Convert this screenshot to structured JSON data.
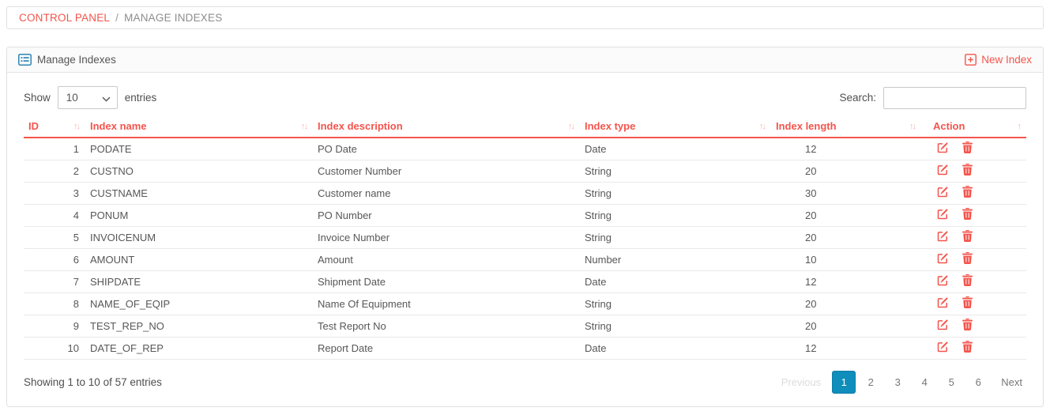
{
  "breadcrumb": {
    "control_panel": "CONTROL PANEL",
    "separator": "/",
    "current": "MANAGE INDEXES"
  },
  "panel": {
    "title": "Manage Indexes",
    "new_index_label": "New Index"
  },
  "controls": {
    "show_label": "Show",
    "page_length": "10",
    "entries_label": "entries",
    "search_label": "Search:",
    "search_value": ""
  },
  "table": {
    "columns": [
      {
        "label": "ID",
        "sort_icon": "↑↓"
      },
      {
        "label": "Index name",
        "sort_icon": "↑↓"
      },
      {
        "label": "Index description",
        "sort_icon": "↑↓"
      },
      {
        "label": "Index type",
        "sort_icon": "↑↓"
      },
      {
        "label": "Index length",
        "sort_icon": "↑↓"
      },
      {
        "label": "Action",
        "sort_icon": "↑"
      }
    ],
    "rows": [
      {
        "id": "1",
        "name": "PODATE",
        "description": "PO Date",
        "type": "Date",
        "length": "12"
      },
      {
        "id": "2",
        "name": "CUSTNO",
        "description": "Customer Number",
        "type": "String",
        "length": "20"
      },
      {
        "id": "3",
        "name": "CUSTNAME",
        "description": "Customer name",
        "type": "String",
        "length": "30"
      },
      {
        "id": "4",
        "name": "PONUM",
        "description": "PO Number",
        "type": "String",
        "length": "20"
      },
      {
        "id": "5",
        "name": "INVOICENUM",
        "description": "Invoice Number",
        "type": "String",
        "length": "20"
      },
      {
        "id": "6",
        "name": "AMOUNT",
        "description": "Amount",
        "type": "Number",
        "length": "10"
      },
      {
        "id": "7",
        "name": "SHIPDATE",
        "description": "Shipment Date",
        "type": "Date",
        "length": "12"
      },
      {
        "id": "8",
        "name": "NAME_OF_EQIP",
        "description": "Name Of Equipment",
        "type": "String",
        "length": "20"
      },
      {
        "id": "9",
        "name": "TEST_REP_NO",
        "description": "Test Report No",
        "type": "String",
        "length": "20"
      },
      {
        "id": "10",
        "name": "DATE_OF_REP",
        "description": "Report Date",
        "type": "Date",
        "length": "12"
      }
    ]
  },
  "footer": {
    "info": "Showing 1 to 10 of 57 entries",
    "pagination": {
      "previous": "Previous",
      "pages": [
        "1",
        "2",
        "3",
        "4",
        "5",
        "6"
      ],
      "active_page": "1",
      "next": "Next"
    }
  },
  "icons": {
    "panel_icon": "list-alt",
    "new_index_icon": "plus-square",
    "select_chevron_icon": "chevron-down",
    "edit_icon": "pencil-square",
    "delete_icon": "trash",
    "sort_both": "↑↓",
    "sort_up": "↑"
  },
  "colors": {
    "accent_red": "#F4544C",
    "sort_icon_red": "#F6B7B2",
    "active_page_bg": "#0F8DBB",
    "panel_icon_blue": "#2E86B5"
  }
}
